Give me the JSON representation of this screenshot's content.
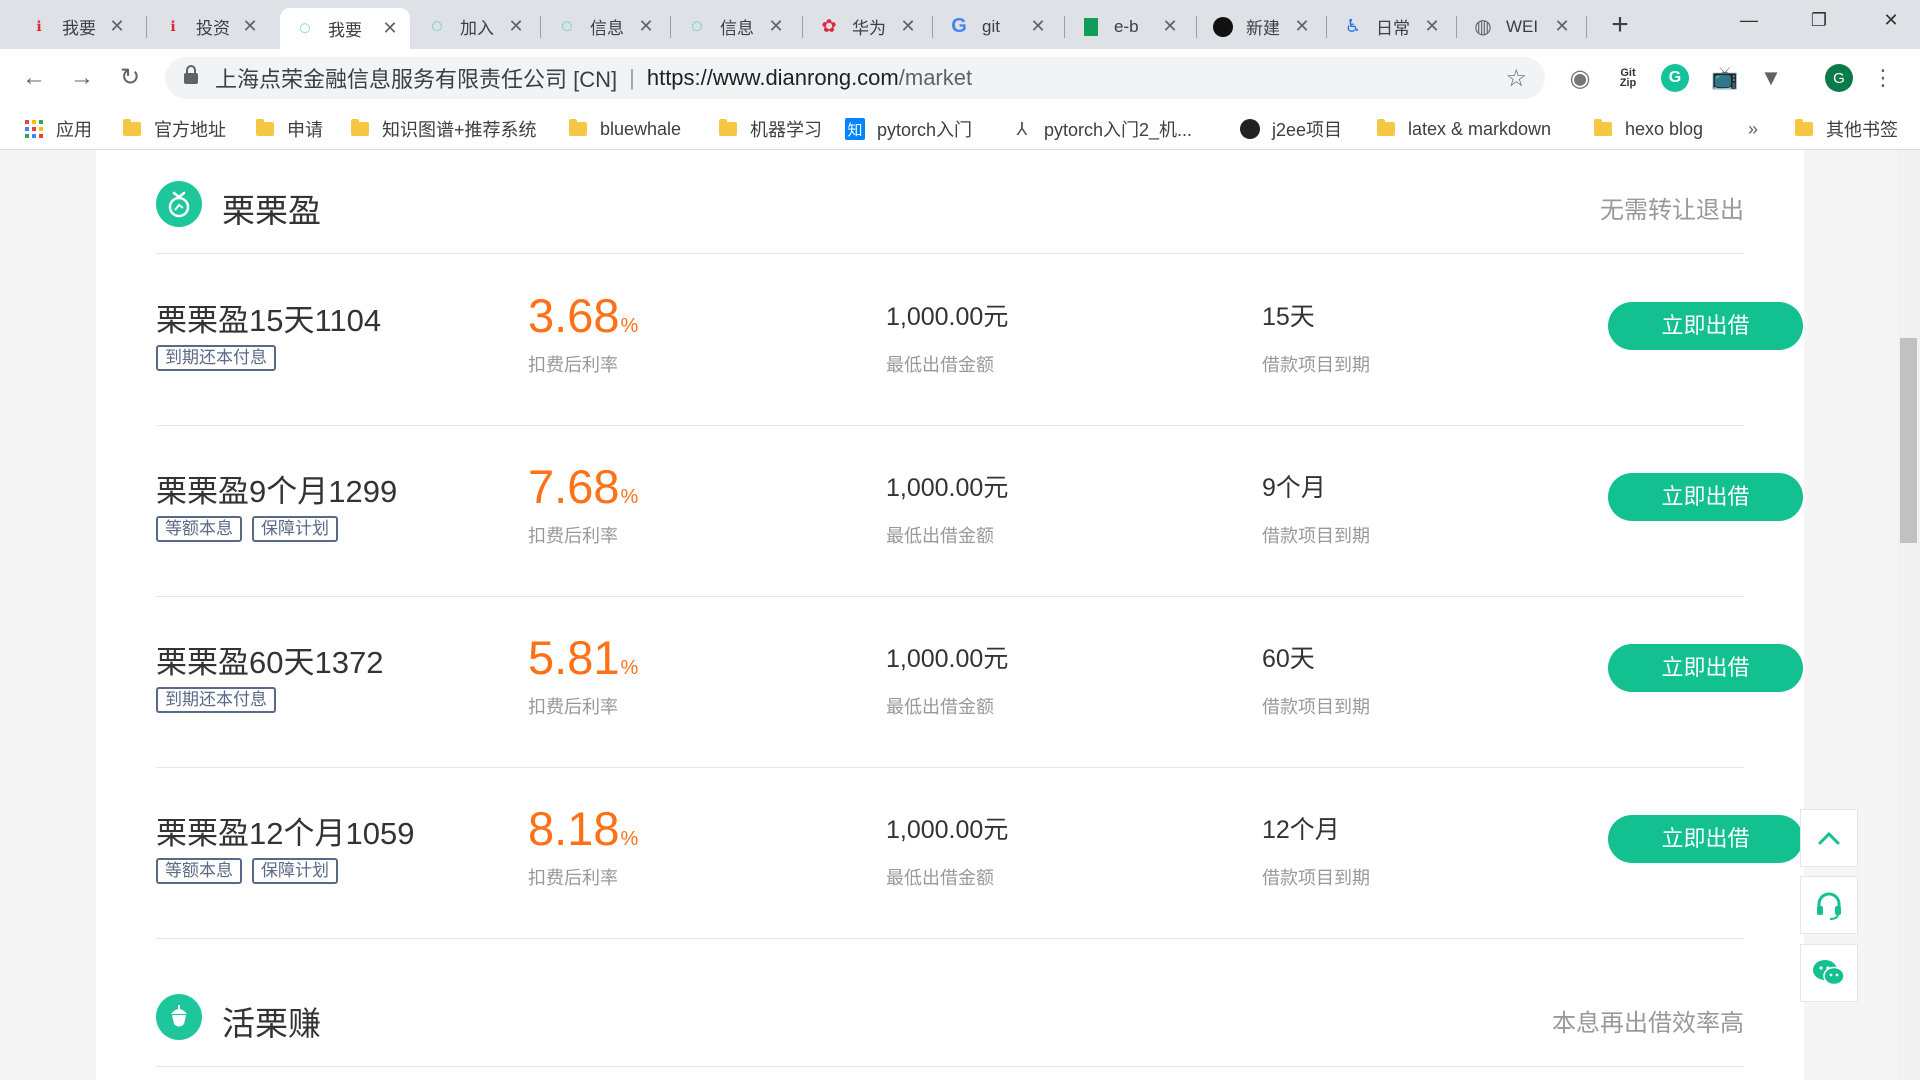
{
  "browser": {
    "tabs": [
      {
        "title": "我要",
        "icon": "diarong-red-icon"
      },
      {
        "title": "投资",
        "icon": "diarong-red-icon"
      },
      {
        "title": "我要",
        "icon": "dianrong-green-icon",
        "active": true
      },
      {
        "title": "加入",
        "icon": "dianrong-green-icon"
      },
      {
        "title": "信息",
        "icon": "dianrong-green-icon"
      },
      {
        "title": "信息",
        "icon": "dianrong-green-icon"
      },
      {
        "title": "华为",
        "icon": "huawei-icon"
      },
      {
        "title": "git",
        "icon": "google-icon"
      },
      {
        "title": "e-b",
        "icon": "book-icon"
      },
      {
        "title": "新建",
        "icon": "black-circle-icon"
      },
      {
        "title": "日常",
        "icon": "person-icon"
      },
      {
        "title": "WEI",
        "icon": "globe-icon"
      }
    ],
    "newtab_label": "+",
    "omnibox": {
      "org": "上海点荣金融信息服务有限责任公司 [CN]",
      "divider": "|",
      "url_host": "https://www.dianrong.com",
      "url_path": "/market"
    },
    "bookmarks": [
      {
        "label": "应用",
        "icon": "apps-grid-icon"
      },
      {
        "label": "官方地址",
        "icon": "folder-icon"
      },
      {
        "label": "申请",
        "icon": "folder-icon"
      },
      {
        "label": "知识图谱+推荐系统",
        "icon": "folder-icon"
      },
      {
        "label": "bluewhale",
        "icon": "folder-icon"
      },
      {
        "label": "机器学习",
        "icon": "folder-icon"
      },
      {
        "label": "pytorch入门",
        "icon": "zhihu-icon"
      },
      {
        "label": "pytorch入门2_机...",
        "icon": "cursor-icon"
      },
      {
        "label": "j2ee项目",
        "icon": "github-icon"
      },
      {
        "label": "latex & markdown",
        "icon": "folder-icon"
      },
      {
        "label": "hexo blog",
        "icon": "folder-icon"
      },
      {
        "label": "»",
        "icon": ""
      },
      {
        "label": "其他书签",
        "icon": "folder-icon"
      }
    ],
    "extensions": {
      "gitzip": "Git\nZip",
      "grammarly": "G",
      "profile": "G"
    }
  },
  "page": {
    "section1": {
      "name": "栗栗盈",
      "desc": "无需转让退出"
    },
    "products": [
      {
        "name": "栗栗盈15天1104",
        "tags": [
          "到期还本付息"
        ],
        "rate": "3.68",
        "rate_unit": "%",
        "rate_label": "扣费后利率",
        "min_amount": "1,000.00元",
        "min_label": "最低出借金额",
        "term": "15天",
        "term_label": "借款项目到期",
        "button": "立即出借"
      },
      {
        "name": "栗栗盈9个月1299",
        "tags": [
          "等额本息",
          "保障计划"
        ],
        "rate": "7.68",
        "rate_unit": "%",
        "rate_label": "扣费后利率",
        "min_amount": "1,000.00元",
        "min_label": "最低出借金额",
        "term": "9个月",
        "term_label": "借款项目到期",
        "button": "立即出借"
      },
      {
        "name": "栗栗盈60天1372",
        "tags": [
          "到期还本付息"
        ],
        "rate": "5.81",
        "rate_unit": "%",
        "rate_label": "扣费后利率",
        "min_amount": "1,000.00元",
        "min_label": "最低出借金额",
        "term": "60天",
        "term_label": "借款项目到期",
        "button": "立即出借"
      },
      {
        "name": "栗栗盈12个月1059",
        "tags": [
          "等额本息",
          "保障计划"
        ],
        "rate": "8.18",
        "rate_unit": "%",
        "rate_label": "扣费后利率",
        "min_amount": "1,000.00元",
        "min_label": "最低出借金额",
        "term": "12个月",
        "term_label": "借款项目到期",
        "button": "立即出借"
      }
    ],
    "section2": {
      "name": "活栗赚",
      "desc": "本息再出借效率高"
    }
  },
  "colors": {
    "accent_green": "#13c08f",
    "rate_orange": "#ff7116",
    "tag_blue": "#5a6a86"
  }
}
